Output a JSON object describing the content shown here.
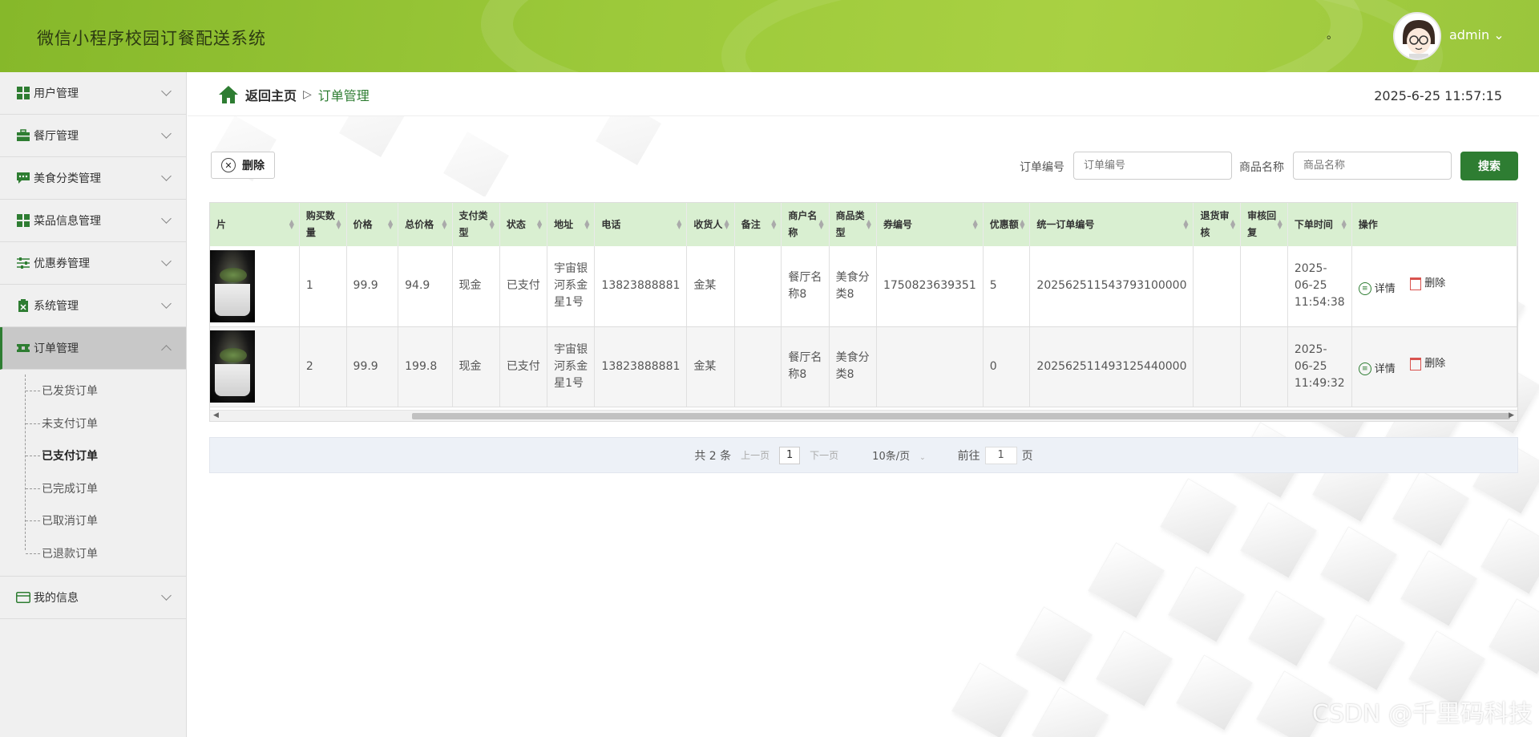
{
  "header": {
    "title": "微信小程序校园订餐配送系统",
    "dot": "。",
    "user": "admin ⌄"
  },
  "sidebar": {
    "items": [
      {
        "label": "用户管理",
        "icon": "grid-icon"
      },
      {
        "label": "餐厅管理",
        "icon": "briefcase-icon"
      },
      {
        "label": "美食分类管理",
        "icon": "chat-icon"
      },
      {
        "label": "菜品信息管理",
        "icon": "grid-icon"
      },
      {
        "label": "优惠券管理",
        "icon": "sliders-icon"
      },
      {
        "label": "系统管理",
        "icon": "clipboard-icon"
      },
      {
        "label": "订单管理",
        "icon": "ticket-icon"
      },
      {
        "label": "我的信息",
        "icon": "card-icon"
      }
    ],
    "order_submenu": [
      "已发货订单",
      "未支付订单",
      "已支付订单",
      "已完成订单",
      "已取消订单",
      "已退款订单"
    ]
  },
  "breadcrumb": {
    "home": "返回主页",
    "sep": "▷",
    "current": "订单管理"
  },
  "datetime": "2025-6-25 11:57:15",
  "toolbar": {
    "delete_label": "删除",
    "order_no_label": "订单编号",
    "order_no_placeholder": "订单编号",
    "product_label": "商品名称",
    "product_placeholder": "商品名称",
    "search_label": "搜索"
  },
  "table": {
    "headers": [
      "片",
      "购买数量",
      "价格",
      "总价格",
      "支付类型",
      "状态",
      "地址",
      "电话",
      "收货人",
      "备注",
      "商户名称",
      "商品类型",
      "券编号",
      "优惠额",
      "统一订单编号",
      "退货审核",
      "审核回复",
      "下单时间",
      "操作"
    ],
    "rows": [
      {
        "qty": "1",
        "price": "99.9",
        "total": "94.9",
        "pay": "现金",
        "status": "已支付",
        "addr": "宇宙银河系金星1号",
        "phone": "13823888881",
        "receiver": "金某",
        "note": "",
        "merchant": "餐厅名称8",
        "type": "美食分类8",
        "coupon": "1750823639351",
        "discount": "5",
        "order_no": "202562511543793100000",
        "ret": "",
        "reply": "",
        "time": "2025-06-25 11:54:38"
      },
      {
        "qty": "2",
        "price": "99.9",
        "total": "199.8",
        "pay": "现金",
        "status": "已支付",
        "addr": "宇宙银河系金星1号",
        "phone": "13823888881",
        "receiver": "金某",
        "note": "",
        "merchant": "餐厅名称8",
        "type": "美食分类8",
        "coupon": "",
        "discount": "0",
        "order_no": "202562511493125440000",
        "ret": "",
        "reply": "",
        "time": "2025-06-25 11:49:32"
      }
    ],
    "ops": {
      "detail": "详情",
      "delete": "删除"
    }
  },
  "pager": {
    "total": "共 2 条",
    "prev": "上一页",
    "page": "1",
    "next": "下一页",
    "size": "10条/页",
    "goto": "前往",
    "goto_val": "1",
    "goto_unit": "页"
  },
  "watermark": "CSDN @千里码科技",
  "colors": {
    "accent": "#2e7d32",
    "header": "#9cc93a",
    "th_bg": "#d9efd1"
  }
}
